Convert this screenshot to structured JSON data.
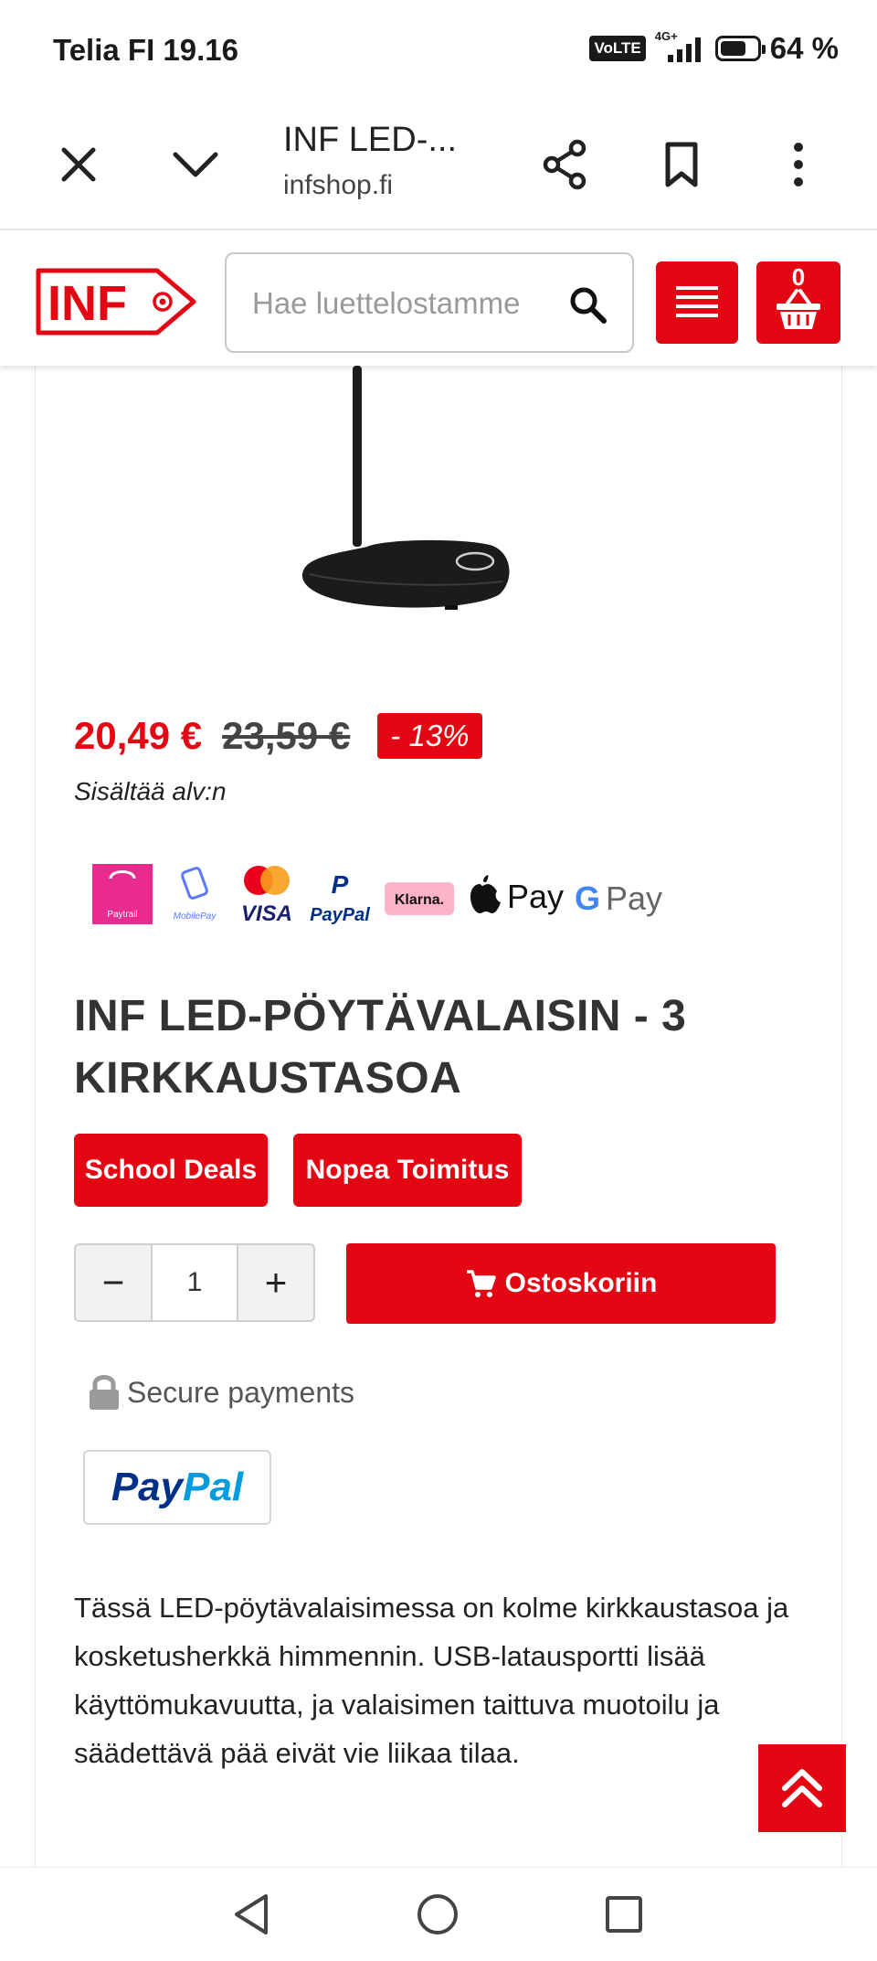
{
  "status_bar": {
    "carrier_time": "Telia FI 19.16",
    "volte": "VoLTE",
    "network": "4G+",
    "battery": "64 %",
    "battery_level": 0.64
  },
  "browser": {
    "page_title": "INF LED-...",
    "host": "infshop.fi"
  },
  "header": {
    "logo_text": "INF",
    "search_placeholder": "Hae luettelostamme",
    "cart_count": "0",
    "brand_color": "#e30613"
  },
  "product": {
    "price": "20,49 €",
    "old_price": "23,59 €",
    "discount": "- 13%",
    "vat_note": "Sisältää alv:n",
    "payment_methods": [
      "Paytrail",
      "MobilePay",
      "Mastercard",
      "VISA",
      "PayPal",
      "Klarna",
      "Apple Pay",
      "Google Pay"
    ],
    "payment_labels": {
      "paytrail": "Paytrail",
      "mobilepay": "MobilePay",
      "visa": "VISA",
      "paypal": "PayPal",
      "klarna": "Klarna.",
      "applepay": "Pay",
      "gpay_g": "G",
      "gpay": "Pay"
    },
    "title": "INF LED-PÖYTÄVALAISIN - 3 KIRKKAUSTASOA",
    "tags": [
      "School Deals",
      "Nopea Toimitus"
    ],
    "quantity": "1",
    "minus": "−",
    "plus": "+",
    "add_to_cart": "Ostoskoriin",
    "secure_payments": "Secure payments",
    "paypal": {
      "part1": "Pay",
      "part2": "Pal"
    },
    "description": "Tässä LED-pöytävalaisimessa on kolme kirkkaustasoa ja kosketusherkkä himmennin. USB-latausportti lisää käyttömukavuutta, ja valaisimen taittuva muotoilu ja säädettävä pää eivät vie liikaa tilaa."
  }
}
